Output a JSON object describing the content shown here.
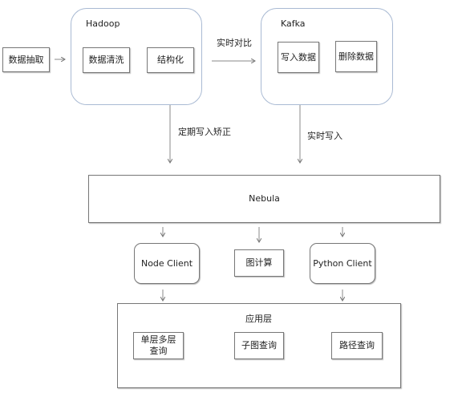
{
  "extract": "数据抽取",
  "hadoop": {
    "title": "Hadoop",
    "clean": "数据清洗",
    "structure": "结构化"
  },
  "kafka": {
    "title": "Kafka",
    "write": "写入数据",
    "delete": "删除数据"
  },
  "edges": {
    "compare": "实时对比",
    "periodic": "定期写入矫正",
    "realtime": "实时写入"
  },
  "nebula": "Nebula",
  "clients": {
    "node": "Node Client",
    "graph_compute": "图计算",
    "python": "Python Client"
  },
  "app": {
    "title": "应用层",
    "multi_hop": "单层多层查询",
    "subgraph": "子图查询",
    "path": "路径查询"
  }
}
